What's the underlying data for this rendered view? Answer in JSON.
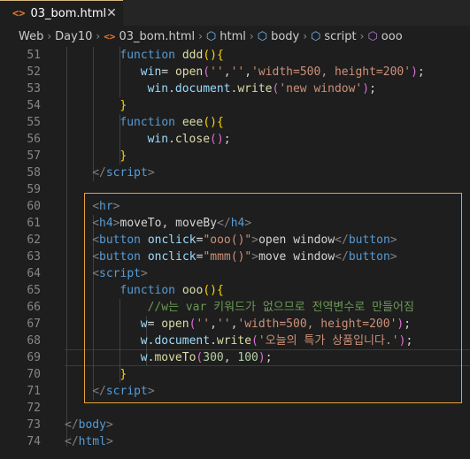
{
  "tab": {
    "icon": "code-icon",
    "title": "03_bom.html",
    "close": "✕"
  },
  "breadcrumb": {
    "items": [
      "Web",
      "Day10",
      "03_bom.html",
      "html",
      "body",
      "script",
      "ooo"
    ],
    "separator": "›"
  },
  "lines": [
    {
      "n": "51",
      "tokens": [
        [
          "kw",
          "function "
        ],
        [
          "fn",
          "ddd"
        ],
        [
          "br1",
          "()"
        ],
        [
          "br1",
          "{"
        ]
      ]
    },
    {
      "n": "52",
      "tokens": [
        [
          "var",
          "win"
        ],
        [
          "pl",
          "= "
        ],
        [
          "fn",
          "open"
        ],
        [
          "br2",
          "("
        ],
        [
          "str",
          "''"
        ],
        [
          "pl",
          ","
        ],
        [
          "str",
          "''"
        ],
        [
          "pl",
          ","
        ],
        [
          "str",
          "'width=500, height=200'"
        ],
        [
          "br2",
          ")"
        ],
        [
          "pl",
          ";"
        ]
      ]
    },
    {
      "n": "53",
      "tokens": [
        [
          "var",
          "win"
        ],
        [
          "pl",
          "."
        ],
        [
          "var",
          "document"
        ],
        [
          "pl",
          "."
        ],
        [
          "fn",
          "write"
        ],
        [
          "br2",
          "("
        ],
        [
          "str",
          "'new window'"
        ],
        [
          "br2",
          ")"
        ],
        [
          "pl",
          ";"
        ]
      ]
    },
    {
      "n": "54",
      "tokens": [
        [
          "br1",
          "}"
        ]
      ]
    },
    {
      "n": "55",
      "tokens": [
        [
          "kw",
          "function "
        ],
        [
          "fn",
          "eee"
        ],
        [
          "br1",
          "()"
        ],
        [
          "br1",
          "{"
        ]
      ]
    },
    {
      "n": "56",
      "tokens": [
        [
          "var",
          "win"
        ],
        [
          "pl",
          "."
        ],
        [
          "fn",
          "close"
        ],
        [
          "br2",
          "()"
        ],
        [
          "pl",
          ";"
        ]
      ]
    },
    {
      "n": "57",
      "tokens": [
        [
          "br1",
          "}"
        ]
      ]
    },
    {
      "n": "58",
      "tokens": [
        [
          "ang",
          "</"
        ],
        [
          "tag",
          "script"
        ],
        [
          "ang",
          ">"
        ]
      ]
    },
    {
      "n": "59",
      "tokens": []
    },
    {
      "n": "60",
      "tokens": [
        [
          "ang",
          "<"
        ],
        [
          "tag",
          "hr"
        ],
        [
          "ang",
          ">"
        ]
      ]
    },
    {
      "n": "61",
      "tokens": [
        [
          "ang",
          "<"
        ],
        [
          "tag",
          "h4"
        ],
        [
          "ang",
          ">"
        ],
        [
          "pl",
          "moveTo, moveBy"
        ],
        [
          "ang",
          "</"
        ],
        [
          "tag",
          "h4"
        ],
        [
          "ang",
          ">"
        ]
      ]
    },
    {
      "n": "62",
      "tokens": [
        [
          "ang",
          "<"
        ],
        [
          "tag",
          "button "
        ],
        [
          "attr",
          "onclick"
        ],
        [
          "pl",
          "="
        ],
        [
          "str",
          "\"ooo()\""
        ],
        [
          "ang",
          ">"
        ],
        [
          "pl",
          "open window"
        ],
        [
          "ang",
          "</"
        ],
        [
          "tag",
          "button"
        ],
        [
          "ang",
          ">"
        ]
      ]
    },
    {
      "n": "63",
      "tokens": [
        [
          "ang",
          "<"
        ],
        [
          "tag",
          "button "
        ],
        [
          "attr",
          "onclick"
        ],
        [
          "pl",
          "="
        ],
        [
          "str",
          "\"mmm()\""
        ],
        [
          "ang",
          ">"
        ],
        [
          "pl",
          "move window"
        ],
        [
          "ang",
          "</"
        ],
        [
          "tag",
          "button"
        ],
        [
          "ang",
          ">"
        ]
      ]
    },
    {
      "n": "64",
      "tokens": [
        [
          "ang",
          "<"
        ],
        [
          "tag",
          "script"
        ],
        [
          "ang",
          ">"
        ]
      ]
    },
    {
      "n": "65",
      "tokens": [
        [
          "kw",
          "function "
        ],
        [
          "fn",
          "ooo"
        ],
        [
          "br1",
          "()"
        ],
        [
          "br1",
          "{"
        ]
      ]
    },
    {
      "n": "66",
      "tokens": [
        [
          "cmt",
          "//w는 var 키워드가 없으므로 전역변수로 만들어짐"
        ]
      ]
    },
    {
      "n": "67",
      "tokens": [
        [
          "var",
          "w"
        ],
        [
          "pl",
          "= "
        ],
        [
          "fn",
          "open"
        ],
        [
          "br2",
          "("
        ],
        [
          "str",
          "''"
        ],
        [
          "pl",
          ","
        ],
        [
          "str",
          "''"
        ],
        [
          "pl",
          ","
        ],
        [
          "str",
          "'width=500, height=200'"
        ],
        [
          "br2",
          ")"
        ],
        [
          "pl",
          ";"
        ]
      ]
    },
    {
      "n": "68",
      "tokens": [
        [
          "var",
          "w"
        ],
        [
          "pl",
          "."
        ],
        [
          "var",
          "document"
        ],
        [
          "pl",
          "."
        ],
        [
          "fn",
          "write"
        ],
        [
          "br2",
          "("
        ],
        [
          "str",
          "'오늘의 특가 상품입니다.'"
        ],
        [
          "br2",
          ")"
        ],
        [
          "pl",
          ";"
        ]
      ]
    },
    {
      "n": "69",
      "tokens": [
        [
          "var",
          "w"
        ],
        [
          "pl",
          "."
        ],
        [
          "fn",
          "moveTo"
        ],
        [
          "br2",
          "("
        ],
        [
          "num",
          "300"
        ],
        [
          "pl",
          ", "
        ],
        [
          "num",
          "100"
        ],
        [
          "br2",
          ")"
        ],
        [
          "pl",
          ";"
        ]
      ]
    },
    {
      "n": "70",
      "tokens": [
        [
          "br1",
          "}"
        ]
      ]
    },
    {
      "n": "71",
      "tokens": [
        [
          "ang",
          "</"
        ],
        [
          "tag",
          "script"
        ],
        [
          "ang",
          ">"
        ]
      ]
    },
    {
      "n": "72",
      "tokens": []
    },
    {
      "n": "73",
      "tokens": [
        [
          "ang",
          "</"
        ],
        [
          "tag",
          "body"
        ],
        [
          "ang",
          ">"
        ]
      ]
    },
    {
      "n": "74",
      "tokens": [
        [
          "ang",
          "</"
        ],
        [
          "tag",
          "html"
        ],
        [
          "ang",
          ">"
        ]
      ]
    }
  ],
  "colors": {
    "background": "#1e1e1e",
    "selection_border": "#e8a33d",
    "tab_accent": "#d7ba7d"
  }
}
